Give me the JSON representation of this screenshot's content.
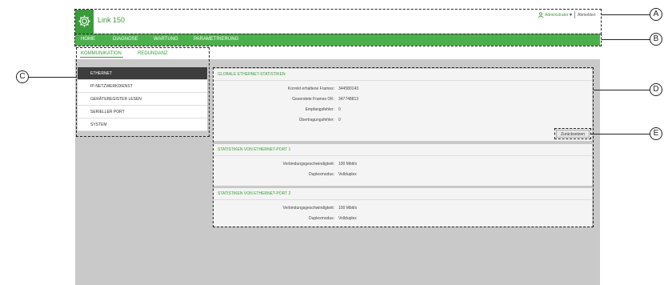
{
  "app": {
    "title": "Link 150"
  },
  "user": {
    "name": "Administrator",
    "logout": "Abmelden"
  },
  "nav": {
    "items": [
      "HOME",
      "DIAGNOSE",
      "WARTUNG",
      "PARAMETRIERUNG"
    ]
  },
  "subnav": {
    "items": [
      "KOMMUNIKATION",
      "REDUNDANZ"
    ]
  },
  "sidebar": {
    "items": [
      "ETHERNET",
      "IP-NETZWERKDIENST",
      "GERÄTEREGISTER LESEN",
      "SERIELLER PORT",
      "SYSTEM"
    ]
  },
  "global_stats": {
    "title": "GLOBALE ETHERNET-STATISTIKEN",
    "rows": [
      {
        "label": "Korrekt erhaltene Frames:",
        "value": "344580143"
      },
      {
        "label": "Gesendete Frames OK:",
        "value": "347748813"
      },
      {
        "label": "Empfangsfehler:",
        "value": "0"
      },
      {
        "label": "Übertragungsfehler:",
        "value": "0"
      }
    ],
    "reset_label": "Zurücksetzen"
  },
  "port1": {
    "title": "STATISTIKEN VON ETHERNET-PORT 1",
    "rows": [
      {
        "label": "Verbindungsgeschwindigkeit:",
        "value": "100 Mbit/s"
      },
      {
        "label": "Duplexmodus:",
        "value": "Vollduplex"
      }
    ]
  },
  "port2": {
    "title": "STATISTIKEN VON ETHERNET-PORT 2",
    "rows": [
      {
        "label": "Verbindungsgeschwindigkeit:",
        "value": "100 Mbit/s"
      },
      {
        "label": "Duplexmodus:",
        "value": "Vollduplex"
      }
    ]
  },
  "callouts": [
    "A",
    "B",
    "C",
    "D",
    "E"
  ],
  "colors": {
    "accent": "#4caf4c",
    "dark": "#3d3d3d",
    "background": "#c9c9c9"
  }
}
